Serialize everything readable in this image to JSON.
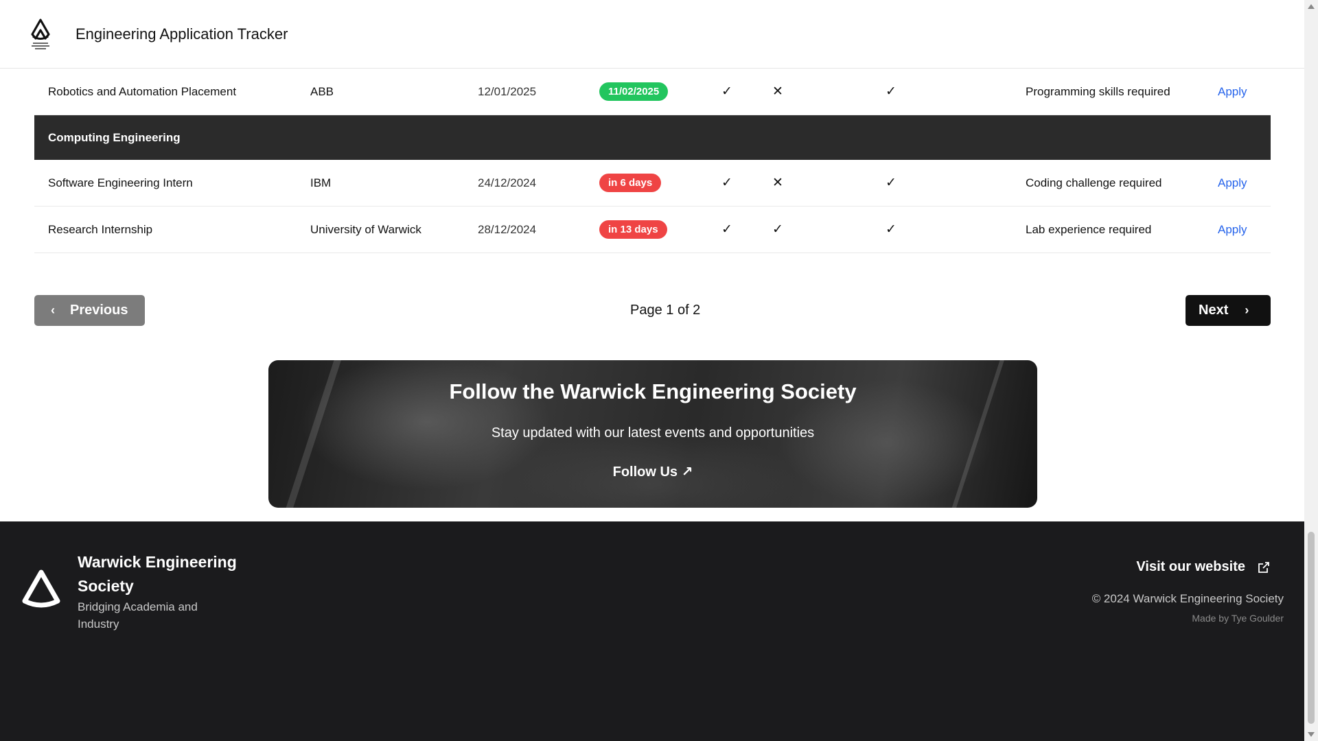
{
  "header": {
    "title": "Engineering Application Tracker"
  },
  "rows": [
    {
      "role": "Robotics and Automation Placement",
      "company": "ABB",
      "opened": "12/01/2025",
      "deadline": "11/02/2025",
      "deadline_color": "#22c55e",
      "cv": "✓",
      "cover": "✕",
      "ref": "✓",
      "notes": "Programming skills required",
      "action": "Apply"
    }
  ],
  "section": {
    "name": "Computing Engineering"
  },
  "rows2": [
    {
      "role": "Software Engineering Intern",
      "company": "IBM",
      "opened": "24/12/2024",
      "deadline": "in 6 days",
      "deadline_color": "#ef4444",
      "cv": "✓",
      "cover": "✕",
      "ref": "✓",
      "notes": "Coding challenge required",
      "action": "Apply"
    },
    {
      "role": "Research Internship",
      "company": "University of Warwick",
      "opened": "28/12/2024",
      "deadline": "in 13 days",
      "deadline_color": "#ef4444",
      "cv": "✓",
      "cover": "✓",
      "ref": "✓",
      "notes": "Lab experience required",
      "action": "Apply"
    }
  ],
  "pagination": {
    "prev": "Previous",
    "indicator": "Page 1 of 2",
    "next": "Next"
  },
  "banner": {
    "title": "Follow the Warwick Engineering Society",
    "subtitle": "Stay updated with our latest events and opportunities",
    "link": "Follow Us ↗"
  },
  "footer": {
    "name": "Warwick Engineering Society",
    "tagline": "Bridging Academia and Industry",
    "visit": "Visit our website",
    "copyright": "© 2024 Warwick Engineering Society",
    "made_by": "Made by Tye Goulder"
  },
  "colors": {
    "accent_link": "#2563eb",
    "badge_green": "#22c55e",
    "badge_red": "#ef4444",
    "footer_bg": "#1b1b1d",
    "section_bg": "#2b2b2b"
  }
}
